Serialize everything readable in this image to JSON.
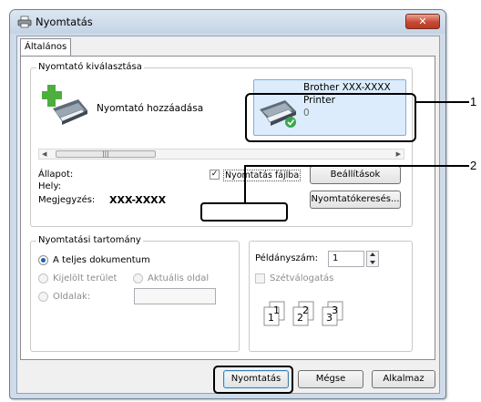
{
  "window": {
    "title": "Nyomtatás",
    "close_glyph": "✕"
  },
  "tabs": [
    {
      "label": "Általános"
    }
  ],
  "printer_select": {
    "legend": "Nyomtató kiválasztása",
    "add_printer_label": "Nyomtató hozzáadása",
    "printer": {
      "name": "Brother XXX-XXXX",
      "line2": "Printer",
      "jobs": "0"
    },
    "status_label": "Állapot:",
    "location_label": "Hely:",
    "comment_label": "Megjegyzés:",
    "comment_value": "XXX-XXXX",
    "print_to_file_label": "Nyomtatás fájlba",
    "print_to_file_checked": true,
    "preferences_button": "Beállítások",
    "find_printer_button": "Nyomtatókeresés..."
  },
  "page_range": {
    "legend": "Nyomtatási tartomány",
    "options": [
      {
        "label": "A teljes dokumentum",
        "selected": true,
        "enabled": true
      },
      {
        "label": "Kijelölt terület",
        "selected": false,
        "enabled": false
      },
      {
        "label": "Aktuális oldal",
        "selected": false,
        "enabled": false
      },
      {
        "label": "Oldalak:",
        "selected": false,
        "enabled": false
      }
    ],
    "pages_value": ""
  },
  "copies": {
    "label": "Példányszám:",
    "value": "1",
    "collate_label": "Szétválogatás",
    "collate_checked": false,
    "collate_icon_pages": [
      "1",
      "1",
      "2",
      "2",
      "3",
      "3"
    ]
  },
  "footer": {
    "print_button": "Nyomtatás",
    "cancel_button": "Mégse",
    "apply_button": "Alkalmaz"
  },
  "callouts": [
    "1",
    "2"
  ],
  "colors": {
    "title_bg": "#cfdbe8",
    "close": "#c84a34",
    "accent": "#3c7fb1"
  }
}
